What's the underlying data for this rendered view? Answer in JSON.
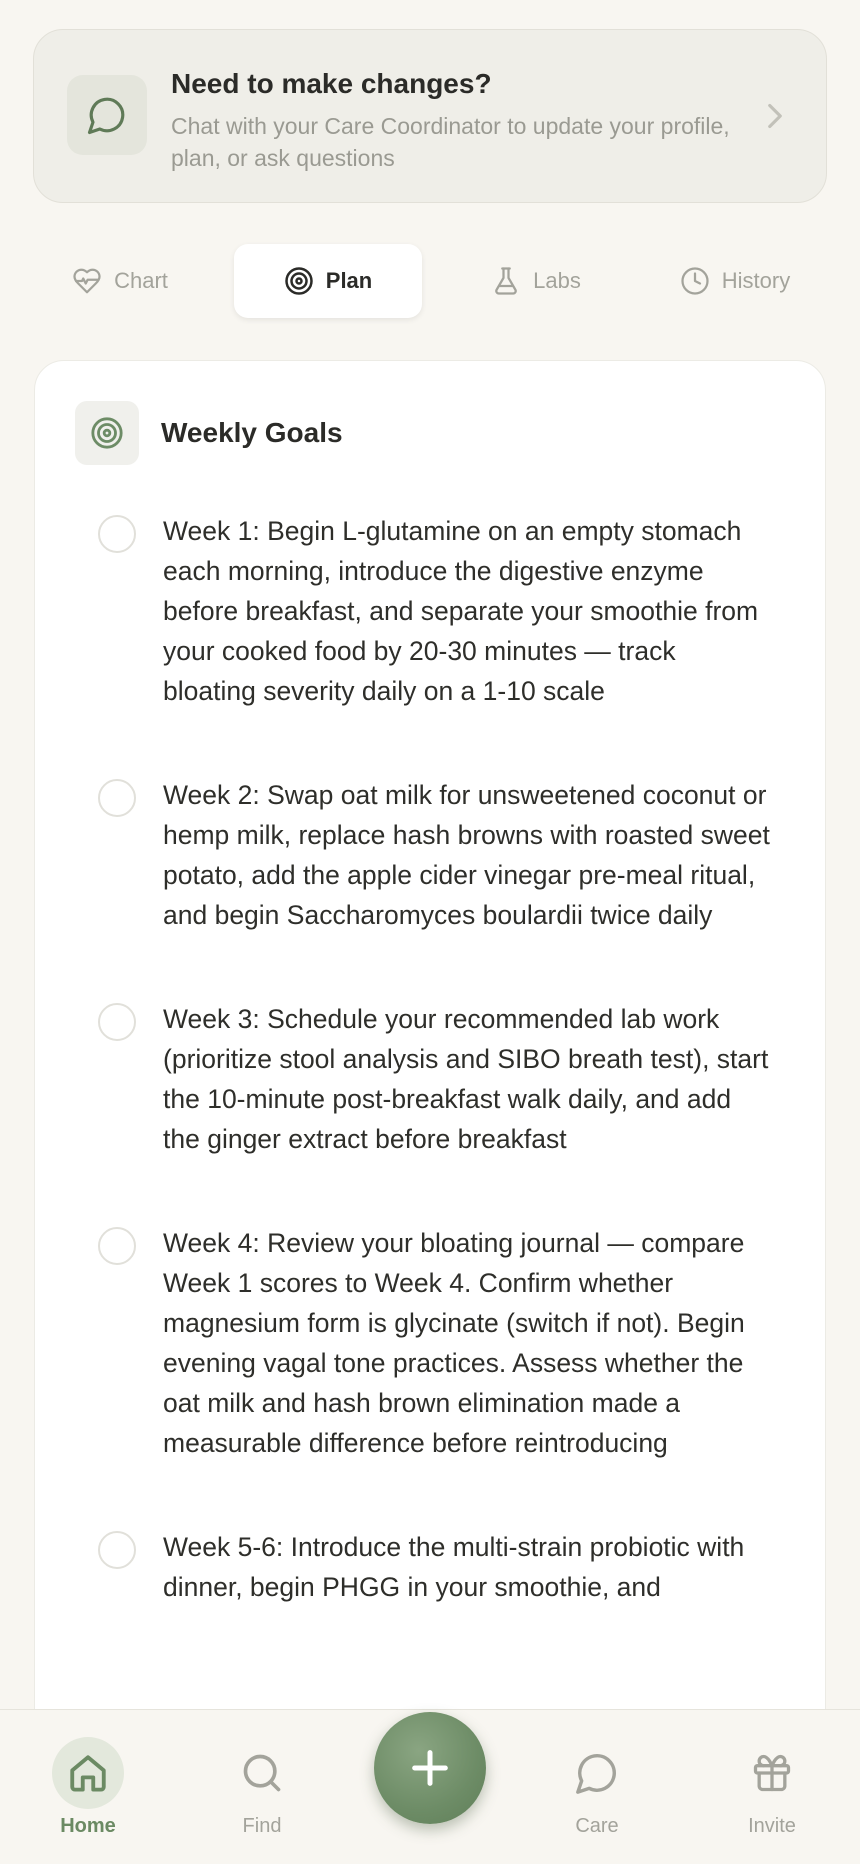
{
  "banner": {
    "title": "Need to make changes?",
    "subtitle": "Chat with your Care Coordinator to update your profile, plan, or ask questions",
    "icon": "chat-bubble-icon"
  },
  "tabs": [
    {
      "label": "Chart",
      "icon": "heart-pulse-icon",
      "active": false
    },
    {
      "label": "Plan",
      "icon": "target-icon",
      "active": true
    },
    {
      "label": "Labs",
      "icon": "flask-icon",
      "active": false
    },
    {
      "label": "History",
      "icon": "clock-icon",
      "active": false
    }
  ],
  "weekly_goals": {
    "title": "Weekly Goals",
    "items": [
      {
        "text": "Week 1: Begin L-glutamine on an empty stomach each morning, introduce the digestive enzyme before breakfast, and separate your smoothie from your cooked food by 20-30 minutes — track bloating severity daily on a 1-10 scale",
        "checked": false
      },
      {
        "text": "Week 2: Swap oat milk for unsweetened coconut or hemp milk, replace hash browns with roasted sweet potato, add the apple cider vinegar pre-meal ritual, and begin Saccharomyces boulardii twice daily",
        "checked": false
      },
      {
        "text": "Week 3: Schedule your recommended lab work (prioritize stool analysis and SIBO breath test), start the 10-minute post-breakfast walk daily, and add the ginger extract before breakfast",
        "checked": false
      },
      {
        "text": "Week 4: Review your bloating journal — compare Week 1 scores to Week 4. Confirm whether magnesium form is glycinate (switch if not). Begin evening vagal tone practices. Assess whether the oat milk and hash brown elimination made a measurable difference before reintroducing",
        "checked": false
      },
      {
        "text": "Week 5-6: Introduce the multi-strain probiotic with dinner, begin PHGG in your smoothie, and",
        "checked": false
      }
    ]
  },
  "bottom_nav": {
    "items": [
      {
        "label": "Home",
        "icon": "home-icon",
        "active": true
      },
      {
        "label": "Find",
        "icon": "search-icon",
        "active": false
      },
      {
        "label": "Care",
        "icon": "chat-bubble-icon",
        "active": false
      },
      {
        "label": "Invite",
        "icon": "gift-icon",
        "active": false
      }
    ],
    "fab_icon": "plus-icon"
  },
  "colors": {
    "accent": "#6d8c66",
    "background": "#f8f6f1",
    "muted_text": "#a3a39b"
  }
}
